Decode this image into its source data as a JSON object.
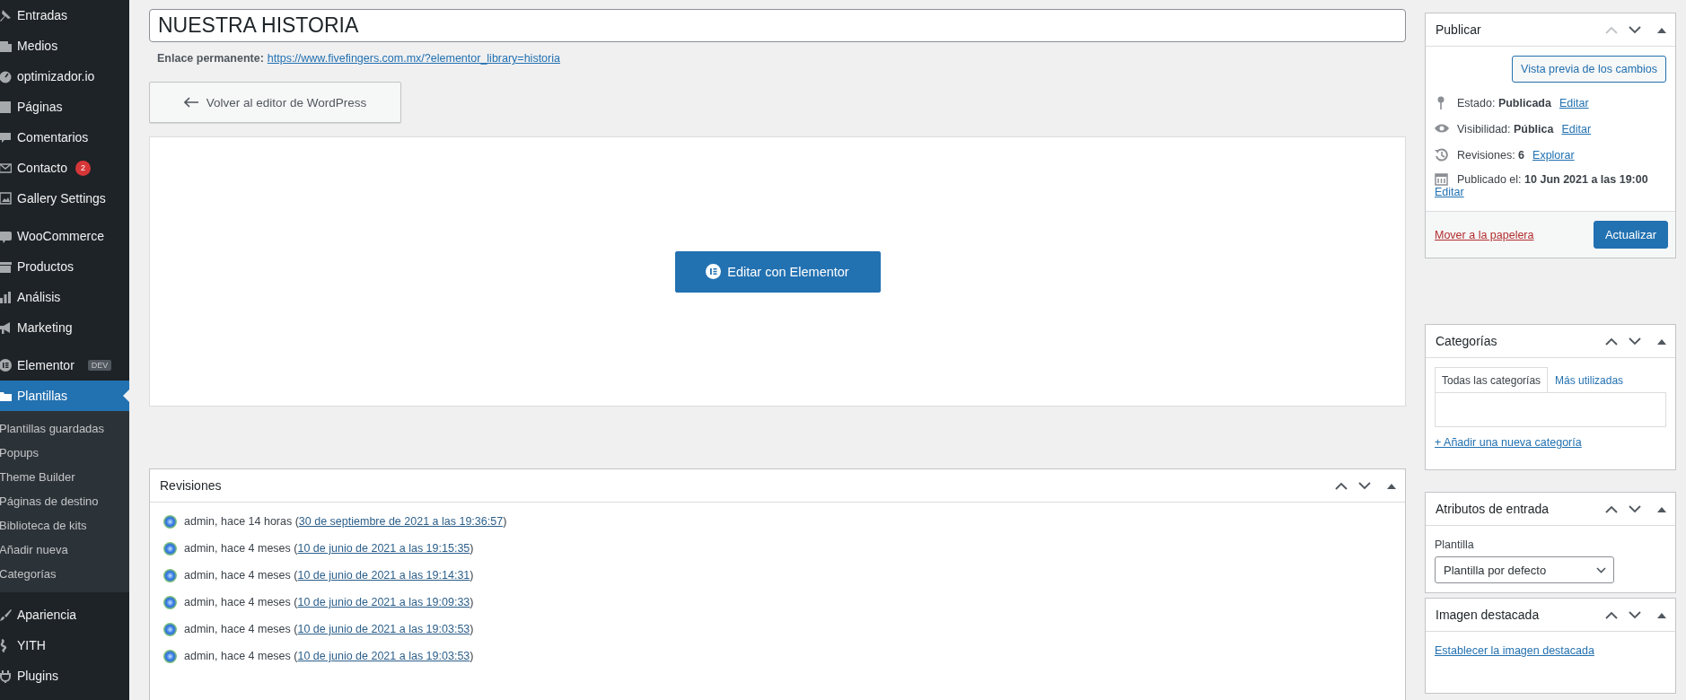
{
  "sidebar": {
    "groups": [
      [
        {
          "label": "Entradas",
          "selected": false
        },
        {
          "label": "Medios",
          "selected": false
        },
        {
          "label": "optimizador.io",
          "selected": false
        },
        {
          "label": "Páginas",
          "selected": false
        },
        {
          "label": "Comentarios",
          "selected": false
        },
        {
          "label": "Contacto",
          "badge": "2",
          "selected": false
        },
        {
          "label": "Gallery Settings",
          "selected": false
        }
      ],
      [
        {
          "label": "WooCommerce",
          "selected": false
        },
        {
          "label": "Productos",
          "selected": false
        },
        {
          "label": "Análisis",
          "selected": false
        },
        {
          "label": "Marketing",
          "selected": false
        }
      ],
      [
        {
          "label": "Elementor",
          "tag": "DEV",
          "selected": false
        },
        {
          "label": "Plantillas",
          "selected": true,
          "children": [
            "Plantillas guardadas",
            "Popups",
            "Theme Builder",
            "Páginas de destino",
            "Biblioteca de kits",
            "Añadir nueva",
            "Categorías"
          ]
        }
      ],
      [
        {
          "label": "Apariencia",
          "selected": false
        },
        {
          "label": "YITH",
          "selected": false
        },
        {
          "label": "Plugins",
          "selected": false
        }
      ]
    ]
  },
  "title_field": {
    "value": "NUESTRA HISTORIA"
  },
  "permalink": {
    "label": "Enlace permanente:",
    "url": "https://www.fivefingers.com.mx/?elementor_library=historia"
  },
  "back_button": "Volver al editor de WordPress",
  "elementor_button": "Editar con Elementor",
  "revisions": {
    "title": "Revisiones",
    "up_disabled": false,
    "rows": [
      {
        "prefix": "admin, hace 14 horas (",
        "link": "30 de septiembre de 2021 a las 19:36:57",
        "suffix": ")"
      },
      {
        "prefix": "admin, hace 4 meses (",
        "link": "10 de junio de 2021 a las 19:15:35",
        "suffix": ")"
      },
      {
        "prefix": "admin, hace 4 meses (",
        "link": "10 de junio de 2021 a las 19:14:31",
        "suffix": ")"
      },
      {
        "prefix": "admin, hace 4 meses (",
        "link": "10 de junio de 2021 a las 19:09:33",
        "suffix": ")"
      },
      {
        "prefix": "admin, hace 4 meses (",
        "link": "10 de junio de 2021 a las 19:03:53",
        "suffix": ")"
      },
      {
        "prefix": "admin, hace 4 meses (",
        "link": "10 de junio de 2021 a las 19:03:53",
        "suffix": ")"
      }
    ]
  },
  "publish": {
    "title": "Publicar",
    "up_disabled": true,
    "preview_button": "Vista previa de los cambios",
    "rows": [
      {
        "label": "Estado:",
        "value": "Publicada",
        "link": "Editar"
      },
      {
        "label": "Visibilidad:",
        "value": "Pública",
        "link": "Editar"
      },
      {
        "label": "Revisiones:",
        "value": "6",
        "link": "Explorar"
      },
      {
        "label": "Publicado el:",
        "value": "10 Jun 2021 a las 19:00",
        "link": "Editar"
      }
    ],
    "trash_link": "Mover a la papelera",
    "update_button": "Actualizar"
  },
  "categories": {
    "title": "Categorías",
    "up_disabled": false,
    "tabs": [
      {
        "label": "Todas las categorías",
        "selected": true
      },
      {
        "label": "Más utilizadas",
        "selected": false
      }
    ],
    "add_link": "+ Añadir una nueva categoría"
  },
  "attributes": {
    "title": "Atributos de entrada",
    "up_disabled": false,
    "label": "Plantilla",
    "select": "Plantilla por defecto"
  },
  "featured_image": {
    "title": "Imagen destacada",
    "up_disabled": false,
    "link": "Establecer la imagen destacada"
  }
}
